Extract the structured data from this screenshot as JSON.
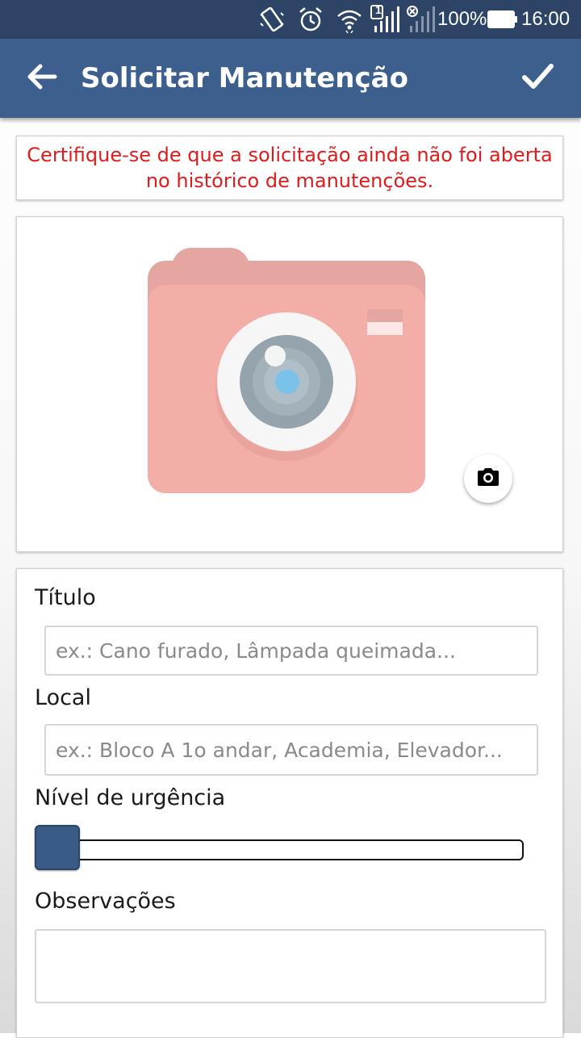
{
  "status_bar": {
    "battery_percent": "100%",
    "time": "16:00",
    "sim_badge": "1",
    "icons": [
      "vibrate-icon",
      "alarm-icon",
      "wifi-icon",
      "signal-sim1-icon",
      "signal-sim2-icon",
      "battery-icon"
    ]
  },
  "app_bar": {
    "title": "Solicitar Manutenção",
    "back_icon": "arrow-left-icon",
    "confirm_icon": "check-icon",
    "background": "#3c5f8e"
  },
  "warning": {
    "text": "Certifique-se de que a solicitação ainda não foi aberta no histórico de manutenções.",
    "color": "#e01b1b"
  },
  "photo": {
    "placeholder_icon": "camera-placeholder-icon",
    "button_icon": "camera-icon"
  },
  "form": {
    "title_label": "Título",
    "title_placeholder": "ex.: Cano furado, Lâmpada queimada...",
    "title_value": "",
    "location_label": "Local",
    "location_placeholder": "ex.: Bloco A 1o andar, Academia, Elevador...",
    "location_value": "",
    "urgency_label": "Nível de urgência",
    "urgency_level": 0,
    "notes_label": "Observações",
    "notes_value": ""
  }
}
